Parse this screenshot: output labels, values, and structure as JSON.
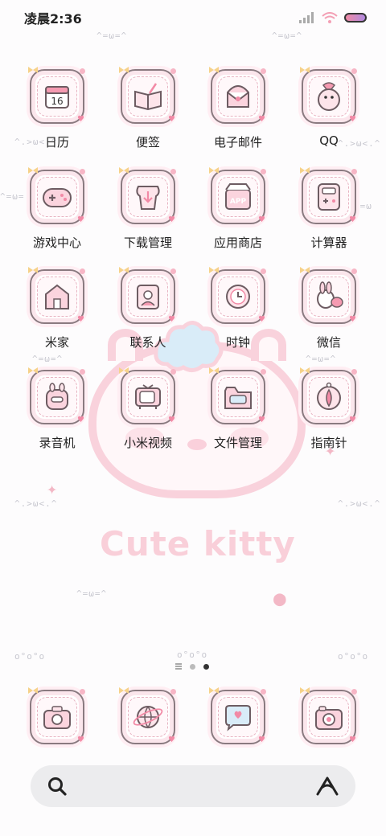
{
  "status_bar": {
    "time": "凌晨2:36",
    "icons": [
      "signal-icon",
      "wifi-icon",
      "battery-icon"
    ]
  },
  "apps": [
    {
      "label": "日历",
      "icon": "calendar-icon",
      "badge": "16"
    },
    {
      "label": "便签",
      "icon": "notes-icon"
    },
    {
      "label": "电子邮件",
      "icon": "email-icon"
    },
    {
      "label": "QQ",
      "icon": "qq-penguin-icon"
    },
    {
      "label": "游戏中心",
      "icon": "gamepad-icon"
    },
    {
      "label": "下载管理",
      "icon": "download-icon"
    },
    {
      "label": "应用商店",
      "icon": "app-store-icon",
      "badge": "APP"
    },
    {
      "label": "计算器",
      "icon": "calculator-icon"
    },
    {
      "label": "米家",
      "icon": "home-icon"
    },
    {
      "label": "联系人",
      "icon": "contacts-icon"
    },
    {
      "label": "时钟",
      "icon": "clock-icon"
    },
    {
      "label": "微信",
      "icon": "wechat-icon"
    },
    {
      "label": "录音机",
      "icon": "recorder-icon"
    },
    {
      "label": "小米视频",
      "icon": "tv-icon"
    },
    {
      "label": "文件管理",
      "icon": "folder-icon"
    },
    {
      "label": "指南针",
      "icon": "compass-icon"
    }
  ],
  "wallpaper": {
    "text": "Cute kitty"
  },
  "page_indicator": {
    "pages": 3,
    "active": 3
  },
  "dock": [
    {
      "icon": "camera-icon"
    },
    {
      "icon": "browser-globe-icon"
    },
    {
      "icon": "messages-icon"
    },
    {
      "icon": "photo-camera-icon"
    }
  ],
  "search": {
    "icons": [
      "search-icon",
      "assistant-icon"
    ]
  },
  "colors": {
    "accent": "#f28aa6",
    "icon_border": "#8a7a80",
    "kitty_pink": "#f9d2dc"
  }
}
